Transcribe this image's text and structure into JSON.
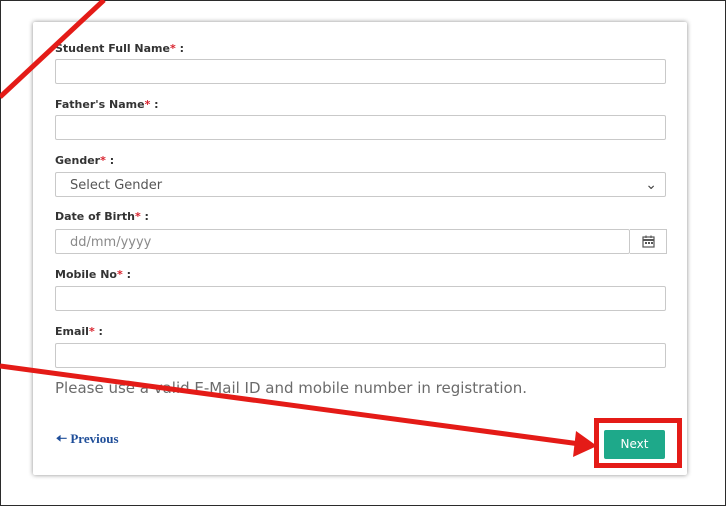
{
  "form": {
    "fields": [
      {
        "label": "Student Full Name",
        "value": ""
      },
      {
        "label": "Father's Name",
        "value": ""
      },
      {
        "label": "Gender",
        "placeholder": "Select Gender"
      },
      {
        "label": "Date of Birth",
        "placeholder": "dd/mm/yyyy"
      },
      {
        "label": "Mobile No",
        "value": ""
      },
      {
        "label": "Email",
        "value": ""
      }
    ],
    "required_mark": "*",
    "label_suffix": " :",
    "note": "Please use a valid E-Mail ID and mobile number in registration.",
    "previous_label": "Previous",
    "previous_icon": "arrow-left-icon",
    "next_label": "Next",
    "calendar_icon": "calendar-icon",
    "select_icon": "chevron-down-icon"
  },
  "colors": {
    "accent": "#1ea98a",
    "required": "#d9232e",
    "link": "#1f4e99",
    "annotation": "#e41b17"
  }
}
